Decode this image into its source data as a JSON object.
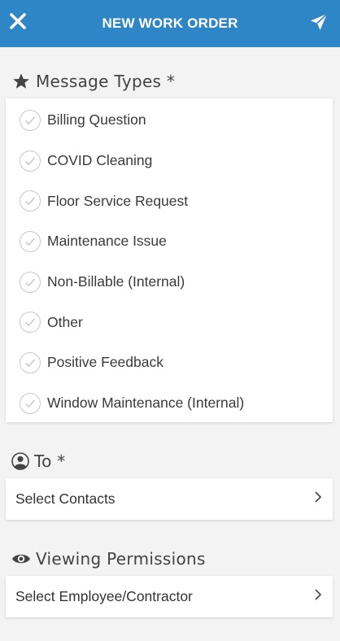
{
  "header": {
    "title": "NEW WORK ORDER",
    "close_icon": "close-icon",
    "send_icon": "send-icon",
    "bg_color": "#2f86c7"
  },
  "message_types": {
    "heading": "Message Types *",
    "icon": "star-icon",
    "items": [
      {
        "label": "Billing Question",
        "checked": false
      },
      {
        "label": "COVID Cleaning",
        "checked": false
      },
      {
        "label": "Floor Service Request",
        "checked": false
      },
      {
        "label": "Maintenance Issue",
        "checked": false
      },
      {
        "label": "Non-Billable (Internal)",
        "checked": false
      },
      {
        "label": "Other",
        "checked": false
      },
      {
        "label": "Positive Feedback",
        "checked": false
      },
      {
        "label": "Window Maintenance (Internal)",
        "checked": false
      }
    ]
  },
  "to": {
    "heading": "To *",
    "icon": "person-icon",
    "select_label": "Select Contacts"
  },
  "viewing_permissions": {
    "heading": "Viewing Permissions",
    "icon": "eye-icon",
    "select_label": "Select Employee/Contractor"
  }
}
